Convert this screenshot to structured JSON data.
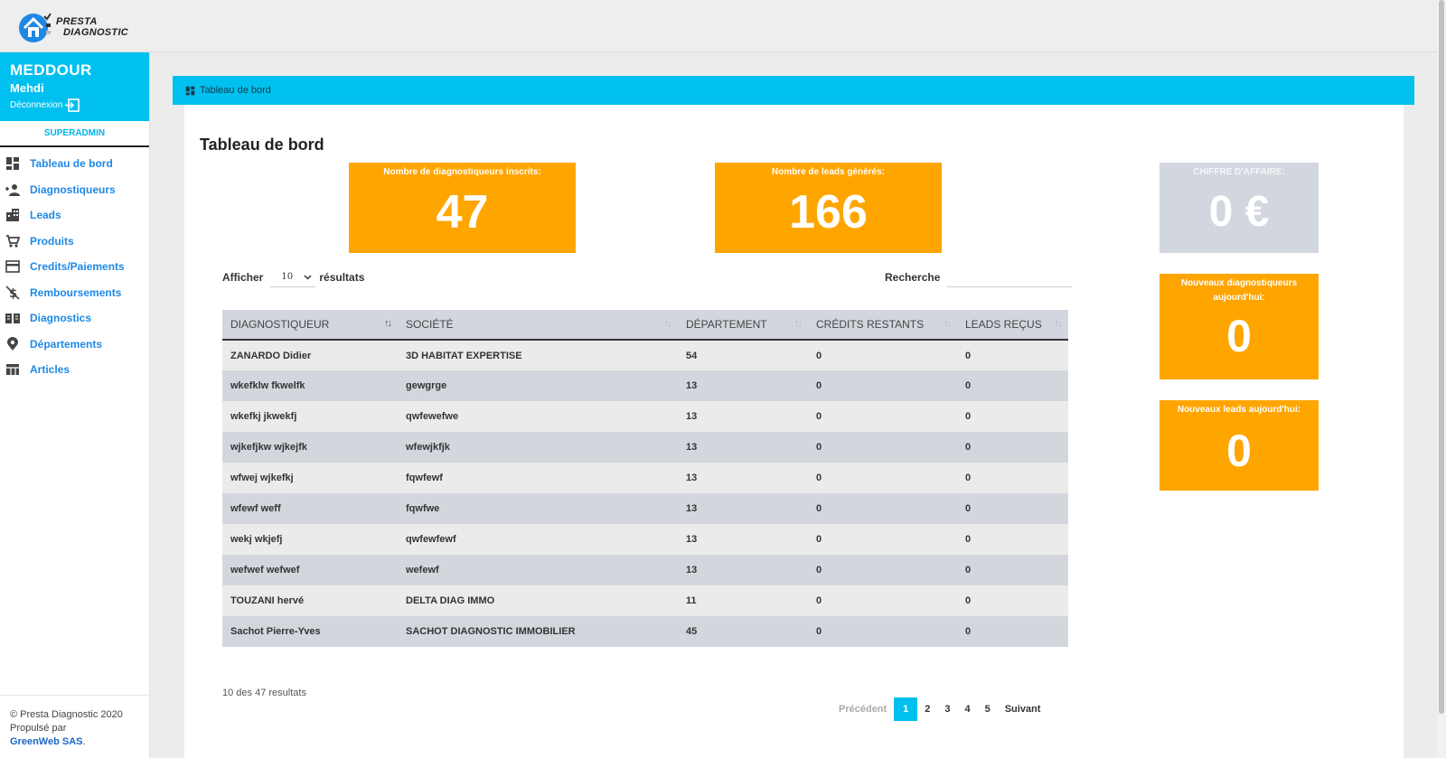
{
  "brand": {
    "line1": "PRESTA",
    "line2": "DIAGNOSTIC"
  },
  "user": {
    "last_name": "MEDDOUR",
    "first_name": "Mehdi",
    "logout_label": "Déconnexion",
    "role": "SUPERADMIN"
  },
  "menu": [
    {
      "label": "Tableau de bord",
      "icon": "dashboard-icon"
    },
    {
      "label": "Diagnostiqueurs",
      "icon": "users-icon"
    },
    {
      "label": "Leads",
      "icon": "building-icon"
    },
    {
      "label": "Produits",
      "icon": "cart-icon"
    },
    {
      "label": "Credits/Paiements",
      "icon": "credit-card-icon"
    },
    {
      "label": "Remboursements",
      "icon": "no-money-icon"
    },
    {
      "label": "Diagnostics",
      "icon": "book-icon"
    },
    {
      "label": "Départements",
      "icon": "map-pin-icon"
    },
    {
      "label": "Articles",
      "icon": "table-icon"
    }
  ],
  "footer": {
    "copyright": "© Presta Diagnostic 2020",
    "powered": "Propulsé par",
    "company": "GreenWeb SAS",
    "dot": "."
  },
  "breadcrumb": {
    "label": "Tableau de bord"
  },
  "page": {
    "title": "Tableau de bord"
  },
  "stats": {
    "diagnosticians": {
      "label": "Nombre de diagnostiqueurs inscrits:",
      "value": "47"
    },
    "leads": {
      "label": "Nombre de leads générés:",
      "value": "166"
    },
    "revenue": {
      "label": "CHIFFRE D'AFFAIRE:",
      "value": "0 €"
    },
    "new_diagnosticians": {
      "label": "Nouveaux diagnostiqueurs aujourd'hui:",
      "value": "0"
    },
    "new_leads": {
      "label": "Nouveaux leads aujourd'hui:",
      "value": "0"
    }
  },
  "table_controls": {
    "show_label": "Afficher",
    "page_size": "10",
    "results_label": "résultats",
    "search_label": "Recherche",
    "search_value": ""
  },
  "table": {
    "columns": [
      "DIAGNOSTIQUEUR",
      "SOCIÉTÉ",
      "DÉPARTEMENT",
      "CRÉDITS RESTANTS",
      "LEADS REÇUS"
    ],
    "rows": [
      [
        "ZANARDO Didier",
        "3D HABITAT EXPERTISE",
        "54",
        "0",
        "0"
      ],
      [
        "wkefklw fkwelfk",
        "gewgrge",
        "13",
        "0",
        "0"
      ],
      [
        "wkefkj jkwekfj",
        "qwfewefwe",
        "13",
        "0",
        "0"
      ],
      [
        "wjkefjkw wjkejfk",
        "wfewjkfjk",
        "13",
        "0",
        "0"
      ],
      [
        "wfwej wjkefkj",
        "fqwfewf",
        "13",
        "0",
        "0"
      ],
      [
        "wfewf weff",
        "fqwfwe",
        "13",
        "0",
        "0"
      ],
      [
        "wekj wkjefj",
        "qwfewfewf",
        "13",
        "0",
        "0"
      ],
      [
        "wefwef wefwef",
        "wefewf",
        "13",
        "0",
        "0"
      ],
      [
        "TOUZANI hervé",
        "DELTA DIAG IMMO",
        "11",
        "0",
        "0"
      ],
      [
        "Sachot Pierre-Yves",
        "SACHOT DIAGNOSTIC IMMOBILIER",
        "45",
        "0",
        "0"
      ]
    ]
  },
  "table_info": "10 des 47 resultats",
  "pagination": {
    "prev": "Précédent",
    "pages": [
      "1",
      "2",
      "3",
      "4",
      "5"
    ],
    "current": "1",
    "next": "Suivant"
  },
  "colors": {
    "accent": "#00c0ef",
    "stat": "#ffa500",
    "grey": "#d2d6de",
    "link": "#1e88e5"
  }
}
